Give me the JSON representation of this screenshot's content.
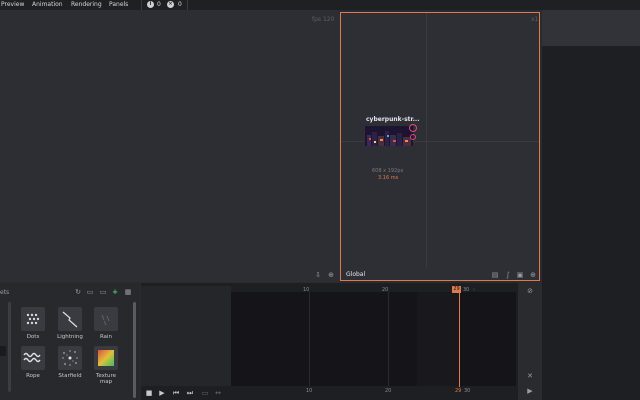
{
  "menu": {
    "items": [
      "Preview",
      "Animation",
      "Rendering",
      "Panels"
    ],
    "info_count": "0",
    "error_count": "0"
  },
  "viewport": {
    "fps_label": "fps 120"
  },
  "preview": {
    "zoom": "x1",
    "layer_name": "cyberpunk-str...",
    "size": "608 x 192px",
    "render_time": "3.16 ms",
    "space_label": "Global"
  },
  "assets": {
    "title": "ets",
    "items": [
      {
        "label": "Dots",
        "icon": "dots-icon"
      },
      {
        "label": "Lightning",
        "icon": "lightning-icon"
      },
      {
        "label": "Rain",
        "icon": "rain-icon"
      },
      {
        "label": "Rope",
        "icon": "rope-icon"
      },
      {
        "label": "Starfield",
        "icon": "starfield-icon"
      },
      {
        "label": "Texture map",
        "icon": "texture-map-icon"
      }
    ]
  },
  "timeline": {
    "ruler_top": [
      "10",
      "20",
      "29",
      "30"
    ],
    "ruler_bottom": [
      "10",
      "20",
      "29",
      "30"
    ],
    "current_frame": "29"
  },
  "colors": {
    "accent": "#e07a4a",
    "background": "#2a2b2f"
  }
}
